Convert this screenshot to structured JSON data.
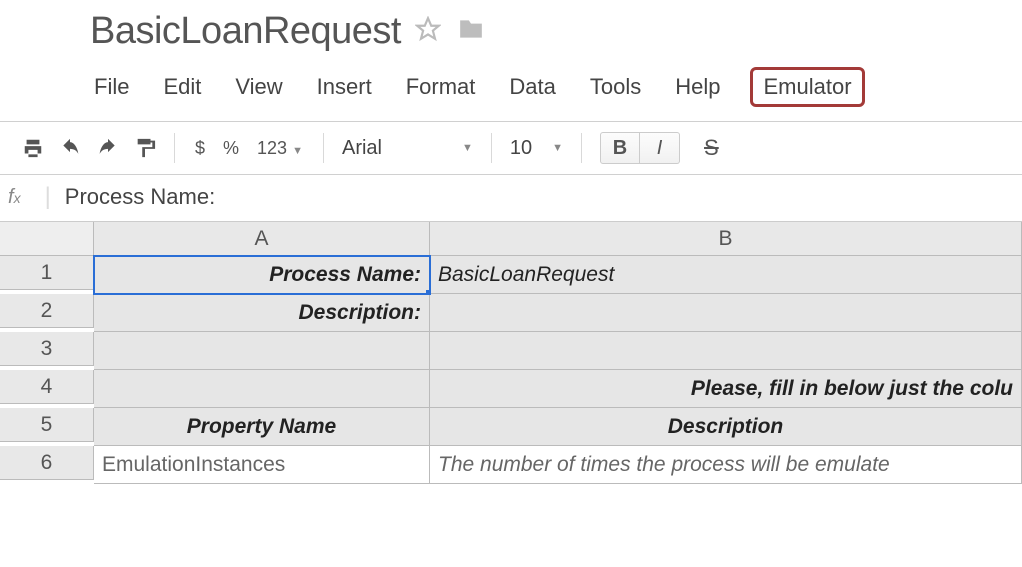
{
  "doc": {
    "title": "BasicLoanRequest"
  },
  "menu": {
    "file": "File",
    "edit": "Edit",
    "view": "View",
    "insert": "Insert",
    "format": "Format",
    "data": "Data",
    "tools": "Tools",
    "help": "Help",
    "emulator": "Emulator"
  },
  "toolbar": {
    "currency": "$",
    "percent": "%",
    "num_format": "123",
    "font_name": "Arial",
    "font_size": "10",
    "bold": "B",
    "italic": "I",
    "strike": "S"
  },
  "formula_bar": {
    "fx": "fx",
    "content": "Process Name:"
  },
  "columns": {
    "A": "A",
    "B": "B"
  },
  "rows": [
    "1",
    "2",
    "3",
    "4",
    "5",
    "6"
  ],
  "cells": {
    "A1": "Process Name:",
    "B1": "BasicLoanRequest",
    "A2": "Description:",
    "B2": "",
    "A3": "",
    "B3": "",
    "A4": "",
    "B4": "Please, fill in below just the colu",
    "A5": "Property Name",
    "B5": "Description",
    "A6": "EmulationInstances",
    "B6": "The number of times the process will be emulate"
  }
}
